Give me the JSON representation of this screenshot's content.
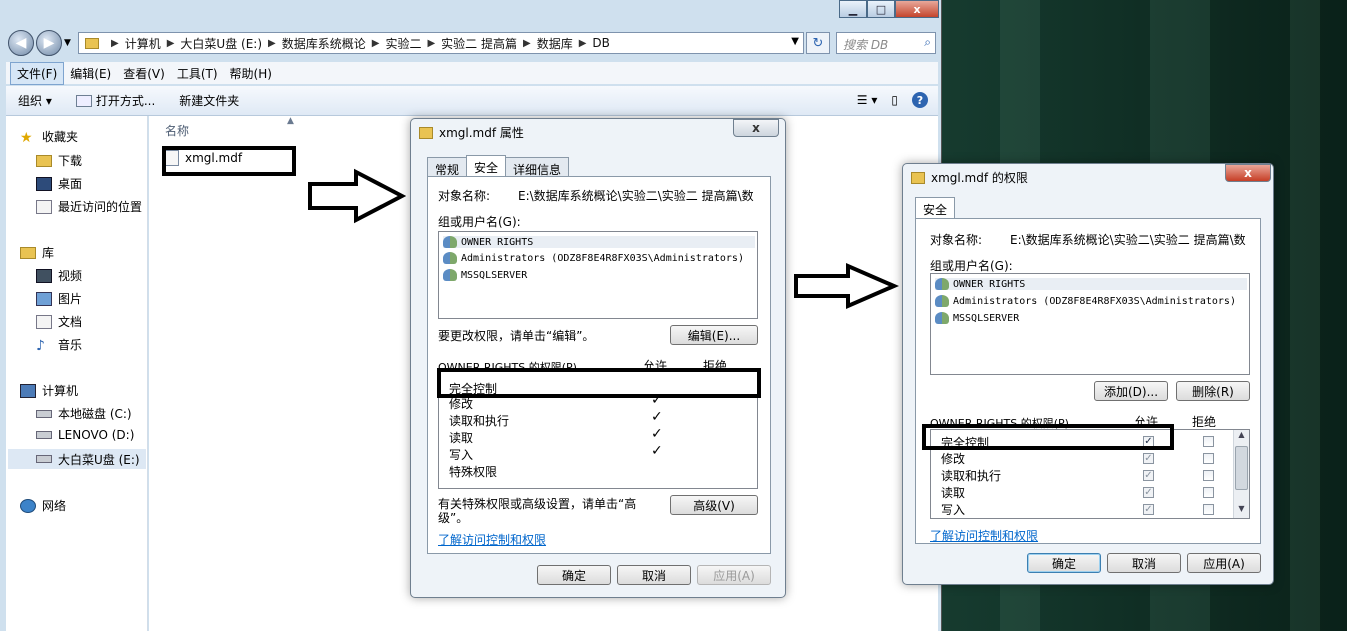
{
  "explorer": {
    "address": [
      "计算机",
      "大白菜U盘 (E:)",
      "数据库系统概论",
      "实验二",
      "实验二 提高篇",
      "数据库",
      "DB"
    ],
    "search_placeholder": "搜索 DB",
    "menu": [
      "文件(F)",
      "编辑(E)",
      "查看(V)",
      "工具(T)",
      "帮助(H)"
    ],
    "toolbar": {
      "organize": "组织 ▾",
      "open_with": "打开方式...",
      "new_folder": "新建文件夹"
    },
    "nav": {
      "favorites": "收藏夹",
      "downloads": "下载",
      "desktop": "桌面",
      "recent": "最近访问的位置",
      "libraries": "库",
      "videos": "视频",
      "pictures": "图片",
      "documents": "文档",
      "music": "音乐",
      "computer": "计算机",
      "drive_c": "本地磁盘 (C:)",
      "drive_d": "LENOVO (D:)",
      "drive_e": "大白菜U盘 (E:)",
      "network": "网络"
    },
    "column_name": "名称",
    "file_name": "xmgl.mdf"
  },
  "props": {
    "title": "xmgl.mdf 属性",
    "tabs": [
      "常规",
      "安全",
      "详细信息"
    ],
    "object_label": "对象名称:",
    "object_value": "E:\\数据库系统概论\\实验二\\实验二 提高篇\\数",
    "group_label": "组或用户名(G):",
    "users": [
      "OWNER RIGHTS",
      "Administrators (ODZ8F8E4R8FX03S\\Administrators)",
      "MSSQLSERVER"
    ],
    "edit_hint": "要更改权限，请单击“编辑”。",
    "edit_btn": "编辑(E)...",
    "perm_label": "OWNER RIGHTS 的权限(P)",
    "allow": "允许",
    "deny": "拒绝",
    "perms": [
      {
        "name": "完全控制",
        "allow": false
      },
      {
        "name": "修改",
        "allow": true
      },
      {
        "name": "读取和执行",
        "allow": true
      },
      {
        "name": "读取",
        "allow": true
      },
      {
        "name": "写入",
        "allow": true
      },
      {
        "name": "特殊权限",
        "allow": false
      }
    ],
    "adv_hint_1": "有关特殊权限或高级设置，请单击“高",
    "adv_hint_2": "级”。",
    "adv_btn": "高级(V)",
    "link": "了解访问控制和权限",
    "ok": "确定",
    "cancel": "取消",
    "apply": "应用(A)"
  },
  "perm_dialog": {
    "title": "xmgl.mdf 的权限",
    "tab": "安全",
    "object_label": "对象名称:",
    "object_value": "E:\\数据库系统概论\\实验二\\实验二 提高篇\\数",
    "group_label": "组或用户名(G):",
    "users": [
      "OWNER RIGHTS",
      "Administrators (ODZ8F8E4R8FX03S\\Administrators)",
      "MSSQLSERVER"
    ],
    "add_btn": "添加(D)...",
    "remove_btn": "删除(R)",
    "perm_label": "OWNER RIGHTS 的权限(P)",
    "allow": "允许",
    "deny": "拒绝",
    "perms": [
      {
        "name": "完全控制",
        "allow": true,
        "deny": false
      },
      {
        "name": "修改",
        "allow": true,
        "deny": false
      },
      {
        "name": "读取和执行",
        "allow": true,
        "deny": false
      },
      {
        "name": "读取",
        "allow": true,
        "deny": false
      },
      {
        "name": "写入",
        "allow": true,
        "deny": false
      }
    ],
    "link": "了解访问控制和权限",
    "ok": "确定",
    "cancel": "取消",
    "apply": "应用(A)"
  },
  "icons": {
    "check": "✓",
    "close": "x",
    "minimize": "▁",
    "maximize": "□"
  }
}
